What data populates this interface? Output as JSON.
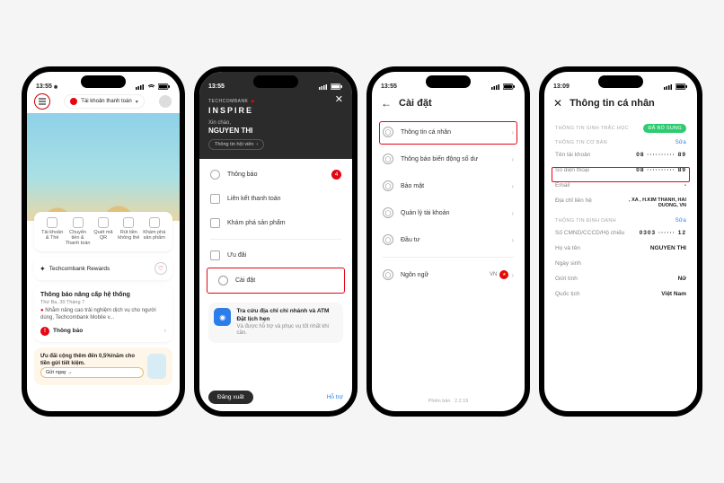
{
  "statusbar": {
    "time": "13:55"
  },
  "p1": {
    "account_pill": "Tài khoản thanh toán",
    "actions": [
      "Tài khoản & Thẻ",
      "Chuyển tiền & Thanh toán",
      "Quét mã QR",
      "Rút tiền không thẻ",
      "Khám phá sản phẩm"
    ],
    "rewards": "Techcombank Rewards",
    "news_title": "Thông báo nâng cấp hệ thống",
    "news_date": "Thứ Ba, 30 Tháng 7",
    "news_body": "Nhằm nâng cao trải nghiệm dịch vụ cho người dùng, Techcombank Mobile v...",
    "news_link": "Thông báo",
    "promo_text": "Ưu đãi cộng thêm đến 0,5%/năm cho tiền gửi tiết kiệm.",
    "promo_cta": "Gửi ngay"
  },
  "p2": {
    "brand": "TECHCOMBANK",
    "tier": "INSPIRE",
    "greet": "Xin chào,",
    "name": "NGUYEN THI",
    "member": "Thông tin hội viên",
    "items": [
      "Thông báo",
      "Liên kết thanh toán",
      "Khám phá sản phẩm",
      "Ưu đãi",
      "Cài đặt"
    ],
    "branch_title": "Tra cứu địa chỉ chi nhánh và ATM",
    "branch_sub": "Đặt lịch hẹn",
    "branch_note": "Và được hỗ trợ và phục vụ tốt nhất khi cần.",
    "logout": "Đăng xuất",
    "support": "Hỗ trợ",
    "badge": "4"
  },
  "p3": {
    "title": "Cài đặt",
    "items": [
      "Thông tin cá nhân",
      "Thông báo biến động số dư",
      "Bảo mật",
      "Quản lý tài khoản",
      "Đầu tư",
      "Ngôn ngữ"
    ],
    "lang": "VN",
    "version_label": "Phiên bản",
    "version": "2.2.19"
  },
  "p4": {
    "title": "Thông tin cá nhân",
    "sec_bio": "THÔNG TIN SINH TRẮC HỌC",
    "bio_status": "Đã bổ sung",
    "sec_basic": "THÔNG TIN CƠ BẢN",
    "edit": "Sửa",
    "k_acct": "Tên tài khoản",
    "v_acct_a": "08",
    "v_acct_b": "89",
    "k_phone": "Số điện thoại",
    "v_phone_a": "08",
    "v_phone_b": "89",
    "k_email": "Email",
    "v_email": "-",
    "k_addr": "Địa chỉ liên hệ",
    "v_addr": ", XA               , H.KIM THANH, HAI DUONG, VN",
    "sec_id": "THÔNG TIN ĐỊNH DANH",
    "k_id": "Số CMND/CCCD/Hộ chiếu",
    "v_id_a": "0303",
    "v_id_b": "12",
    "k_name": "Họ và tên",
    "v_name": "NGUYEN THI",
    "k_dob": "Ngày sinh",
    "v_dob": "",
    "k_sex": "Giới tính",
    "v_sex": "Nữ",
    "k_nat": "Quốc tịch",
    "v_nat": "Việt Nam"
  }
}
